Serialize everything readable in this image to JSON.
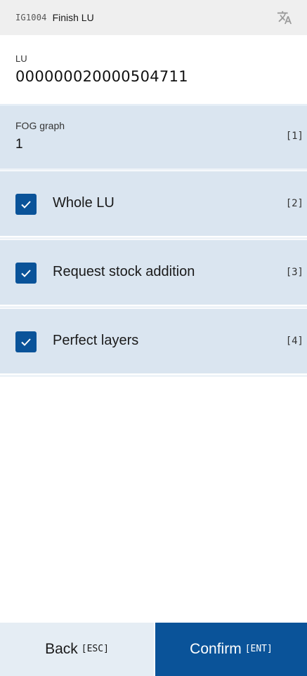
{
  "header": {
    "code": "IG1004",
    "title": "Finish LU",
    "translate_icon": "translate-icon"
  },
  "lu": {
    "label": "LU",
    "value": "000000020000504711"
  },
  "fog": {
    "label": "FOG graph",
    "value": "1",
    "key": "[1]"
  },
  "options": [
    {
      "label": "Whole LU",
      "key": "[2]",
      "checked": true
    },
    {
      "label": "Request stock addition",
      "key": "[3]",
      "checked": true
    },
    {
      "label": "Perfect layers",
      "key": "[4]",
      "checked": true
    }
  ],
  "footer": {
    "back_label": "Back",
    "back_key": "[ESC]",
    "confirm_label": "Confirm",
    "confirm_key": "[ENT]"
  },
  "colors": {
    "accent": "#0a5399",
    "row_bg": "#dae5f0",
    "header_bg": "#efefef"
  }
}
